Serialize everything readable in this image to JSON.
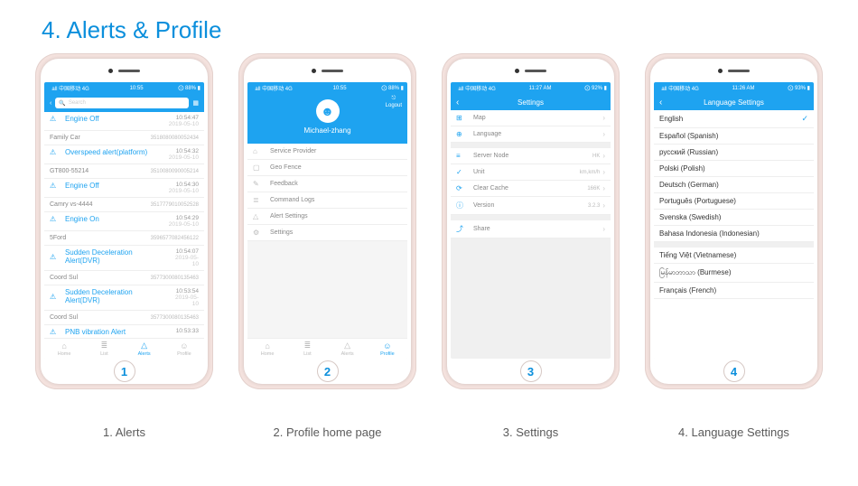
{
  "title": "4. Alerts & Profile",
  "captions": [
    "1. Alerts",
    "2. Profile home page",
    "3. Settings",
    "4. Language Settings"
  ],
  "phone_nums": [
    "1",
    "2",
    "3",
    "4"
  ],
  "status1": {
    "left": "⠀all 中国移动 4G ⠀",
    "time": "10:55",
    "right": "⨀ 88% ▮"
  },
  "status3": {
    "left": "⠀all 中国移动 4G",
    "time": "11:27 AM",
    "right": "⨀ 92% ▮"
  },
  "status4": {
    "left": "⠀all 中国移动 4G",
    "time": "11:26 AM",
    "right": "⨀ 93% ▮"
  },
  "alerts": {
    "search_placeholder": "Search",
    "items": [
      {
        "icon": "⚠",
        "title": "Engine Off",
        "time": "10:54:47",
        "date": "2019-05-10",
        "dev": "Family Car",
        "id": "3518080080052434"
      },
      {
        "icon": "⚠",
        "title": "Overspeed alert(platform)",
        "time": "10:54:32",
        "date": "2019-05-10",
        "dev": "GT800-55214",
        "id": "3510080090005214"
      },
      {
        "icon": "⚠",
        "title": "Engine Off",
        "time": "10:54:30",
        "date": "2019-05-10",
        "dev": "Camry vs-4444",
        "id": "3517779010052528"
      },
      {
        "icon": "⚠",
        "title": "Engine On",
        "time": "10:54:29",
        "date": "2019-05-10",
        "dev": "5Ford",
        "id": "3596577082456122"
      },
      {
        "icon": "⚠",
        "title": "Sudden Deceleration Alert(DVR)",
        "time": "10:54:07",
        "date": "2019-05-10",
        "dev": "Coord Sul",
        "id": "3577300080135463"
      },
      {
        "icon": "⚠",
        "title": "Sudden Deceleration Alert(DVR)",
        "time": "10:53:54",
        "date": "2019-05-10",
        "dev": "Coord Sul",
        "id": "3577300080135463"
      },
      {
        "icon": "⚠",
        "title": "PNB vibration Alert",
        "time": "10:53:33",
        "date": "",
        "dev": "",
        "id": ""
      }
    ],
    "tabs": [
      "Home",
      "List",
      "Alerts",
      "Profile"
    ]
  },
  "profile": {
    "logout": "Logout",
    "name": "Michael-zhang",
    "menu": [
      {
        "icon": "⌂",
        "label": "Service Provider"
      },
      {
        "icon": "▢",
        "label": "Geo Fence"
      },
      {
        "icon": "✎",
        "label": "Feedback"
      },
      {
        "icon": "≣",
        "label": "Command Logs"
      },
      {
        "icon": "△",
        "label": "Alert Settings"
      },
      {
        "icon": "⚙",
        "label": "Settings"
      }
    ],
    "tabs": [
      "Home",
      "List",
      "Alerts",
      "Profile"
    ]
  },
  "settings": {
    "hdr": "Settings",
    "rows": [
      {
        "icon": "⊞",
        "label": "Map",
        "val": ""
      },
      {
        "icon": "⊕",
        "label": "Language",
        "val": ""
      },
      {
        "icon": "≡",
        "label": "Server Node",
        "val": "HK"
      },
      {
        "icon": "✓",
        "label": "Unit",
        "val": "km,km/h"
      },
      {
        "icon": "⟳",
        "label": "Clear Cache",
        "val": "166K"
      },
      {
        "icon": "ⓘ",
        "label": "Version",
        "val": "3.2.3"
      },
      {
        "icon": "⤴",
        "label": "Share",
        "val": ""
      }
    ]
  },
  "lang": {
    "hdr": "Language Settings",
    "rows": [
      {
        "label": "English",
        "sel": true
      },
      {
        "label": "Español (Spanish)"
      },
      {
        "label": "русский (Russian)"
      },
      {
        "label": "Polski (Polish)"
      },
      {
        "label": "Deutsch (German)"
      },
      {
        "label": "Português (Portuguese)"
      },
      {
        "label": "Svenska (Swedish)"
      },
      {
        "label": "Bahasa Indonesia (Indonesian)"
      },
      {
        "label": "Tiếng Việt (Vietnamese)"
      },
      {
        "label": "မြန်မာဘာသာ (Burmese)"
      },
      {
        "label": "Français (French)"
      }
    ]
  }
}
